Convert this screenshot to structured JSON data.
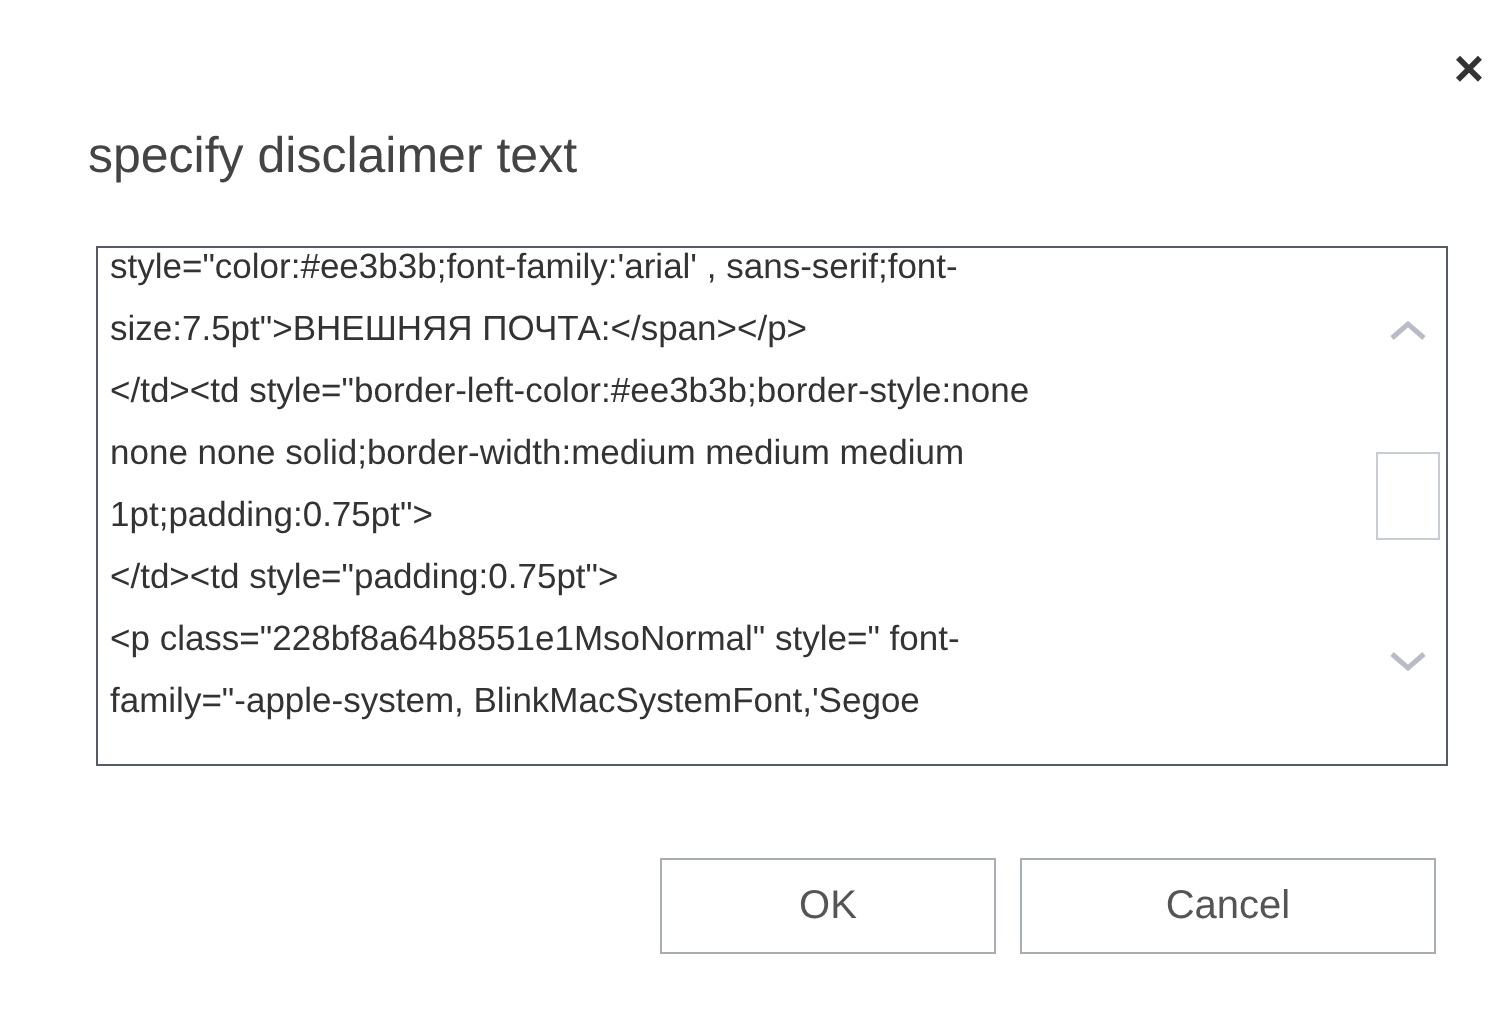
{
  "dialog": {
    "title": "specify disclaimer text",
    "close": "×"
  },
  "text_field": {
    "value": "style=\"color:#ee3b3b;font-family:'arial' , sans-serif;font-\nsize:7.5pt\">ВНЕШНЯЯ ПОЧТА:</span></p>\n</td><td style=\"border-left-color:#ee3b3b;border-style:none\nnone none solid;border-width:medium medium medium\n1pt;padding:0.75pt\">\n</td><td style=\"padding:0.75pt\">\n<p class=\"228bf8a64b8551e1MsoNormal\" style=\" font-\nfamily=\"-apple-system, BlinkMacSystemFont,'Segoe"
  },
  "buttons": [
    {
      "label": "OK",
      "kind": "ok"
    },
    {
      "label": "Cancel",
      "kind": "cancel"
    }
  ]
}
